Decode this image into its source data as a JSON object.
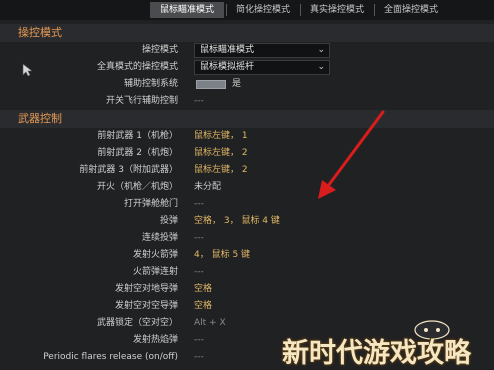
{
  "tabs": [
    {
      "label": "鼠标瞄准模式",
      "active": true
    },
    {
      "label": "简化操控模式",
      "active": false
    },
    {
      "label": "真实操控模式",
      "active": false
    },
    {
      "label": "全面操控模式",
      "active": false
    }
  ],
  "sections": {
    "control_mode": {
      "title": "操控模式",
      "rows": {
        "mode": {
          "label": "操控模式",
          "value": "鼠标瞄准模式"
        },
        "full_real": {
          "label": "全真模式的操控模式",
          "value": "鼠标模拟摇杆"
        },
        "assist": {
          "label": "辅助控制系统",
          "value": "是"
        },
        "flight_assist": {
          "label": "开关飞行辅助控制",
          "value": "---"
        }
      }
    },
    "weapons": {
      "title": "武器控制",
      "rows": [
        {
          "label": "前射武器 1（机枪）",
          "value": "鼠标左键， 1",
          "style": "key"
        },
        {
          "label": "前射武器 2（机炮）",
          "value": "鼠标左键， 2",
          "style": "key"
        },
        {
          "label": "前射武器 3（附加武器）",
          "value": "鼠标左键， 2",
          "style": "key"
        },
        {
          "label": "开火（机枪／机炮）",
          "value": "未分配",
          "style": "plain"
        },
        {
          "label": "打开弹舱舱门",
          "value": "---",
          "style": "dim"
        },
        {
          "label": "投弹",
          "value": "空格， 3， 鼠标 4 键",
          "style": "key"
        },
        {
          "label": "连续投弹",
          "value": "---",
          "style": "dim"
        },
        {
          "label": "发射火箭弹",
          "value": "4， 鼠标 5 键",
          "style": "key"
        },
        {
          "label": "火箭弹连射",
          "value": "---",
          "style": "dim"
        },
        {
          "label": "发射空对地导弹",
          "value": "空格",
          "style": "key"
        },
        {
          "label": "发射空对空导弹",
          "value": "空格",
          "style": "key"
        },
        {
          "label": "武器锁定（空对空）",
          "value": "Alt + X",
          "style": "dim"
        },
        {
          "label": "发射热焰弹",
          "value": "---",
          "style": "dim"
        },
        {
          "label": "Periodic flares release (on/off)",
          "value": "---",
          "style": "dim"
        }
      ]
    }
  },
  "watermark": {
    "text": "新时代游戏攻略"
  },
  "icons": {
    "cursor": "mouse-pointer-icon",
    "annotation": "red-arrow-icon",
    "select_toggle": "chevron-down-icon"
  },
  "colors": {
    "section_title": "#e79a55",
    "key_value": "#e2b866",
    "arrow": "#d91c1c"
  }
}
